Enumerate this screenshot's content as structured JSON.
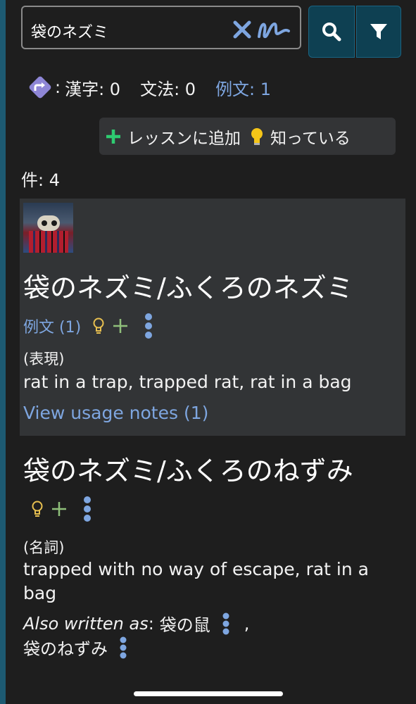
{
  "search": {
    "query": "袋のネズミ"
  },
  "counts": {
    "kanji": "漢字: 0",
    "grammar": "文法: 0",
    "examples": "例文: 1",
    "prefix": ":"
  },
  "actions": {
    "add_lesson": "レッスンに追加",
    "known": "知っている"
  },
  "results": {
    "count_label": "件: 4"
  },
  "entries": [
    {
      "title": "袋のネズミ/ふくろのネズミ",
      "examples_link": "例文 (1)",
      "pos": "(表現)",
      "gloss": "rat in a trap, trapped rat, rat in a bag",
      "usage_link": "View usage notes (1)"
    },
    {
      "title": "袋のネズミ/ふくろのねずみ",
      "pos": "(名詞)",
      "gloss": "trapped with no way of escape, rat in a bag",
      "also_written_label": "Also written as",
      "also_written_colon": ":",
      "alt_forms": [
        "袋の鼠",
        "袋のねずみ"
      ],
      "alt_separator": ","
    }
  ],
  "colors": {
    "background": "#1e1e1e",
    "card": "#323436",
    "link": "#7ea6e0",
    "accent_button": "#0e4052",
    "green": "#2ecc71",
    "yellow": "#f5c518",
    "icon_blue": "#7ea6e0"
  },
  "icons": [
    "clear-icon",
    "handwriting-icon",
    "search-icon",
    "filter-icon",
    "jump-icon",
    "plus-icon",
    "bulb-icon",
    "kebab-icon"
  ]
}
